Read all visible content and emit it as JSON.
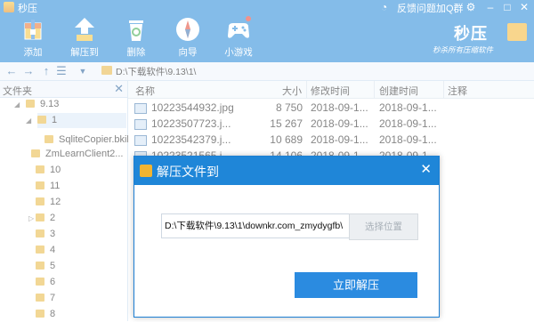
{
  "app": {
    "title": "秒压",
    "feedback": "反馈问题加Q群"
  },
  "toolbar": [
    {
      "label": "添加",
      "icon": "add-archive-icon"
    },
    {
      "label": "解压到",
      "icon": "extract-upload-icon"
    },
    {
      "label": "删除",
      "icon": "recycle-bin-icon"
    },
    {
      "label": "向导",
      "icon": "compass-icon"
    },
    {
      "label": "小游戏",
      "icon": "gamepad-icon"
    }
  ],
  "brand": {
    "name": "秒压",
    "slogan": "秒杀所有压缩软件"
  },
  "address": {
    "path": "D:\\下载软件\\9.13\\1\\"
  },
  "tree": {
    "title": "文件夹",
    "items": [
      "9.13",
      "1",
      "SqliteCopier.bkil...",
      "ZmLearnClient2...",
      "10",
      "11",
      "12",
      "2",
      "3",
      "4",
      "5",
      "6",
      "7",
      "8"
    ]
  },
  "list": {
    "columns": [
      "名称",
      "大小",
      "修改时间",
      "创建时间",
      "注释"
    ],
    "rows": [
      {
        "name": "10223544932.jpg",
        "size": "8 750",
        "modified": "2018-09-1...",
        "created": "2018-09-1..."
      },
      {
        "name": "10223507723.j...",
        "size": "15 267",
        "modified": "2018-09-1...",
        "created": "2018-09-1..."
      },
      {
        "name": "10223542379.j...",
        "size": "10 689",
        "modified": "2018-09-1...",
        "created": "2018-09-1..."
      },
      {
        "name": "10223521565.j...",
        "size": "14 106",
        "modified": "2018-09-1...",
        "created": "2018-09-1..."
      }
    ]
  },
  "dialog": {
    "title": "解压文件到",
    "path_value": "D:\\下载软件\\9.13\\1\\downkr.com_zmydygfb\\",
    "choose_label": "选择位置",
    "extract_label": "立即解压"
  },
  "colors": {
    "accent": "#1f86d8",
    "button": "#2b8be0"
  }
}
